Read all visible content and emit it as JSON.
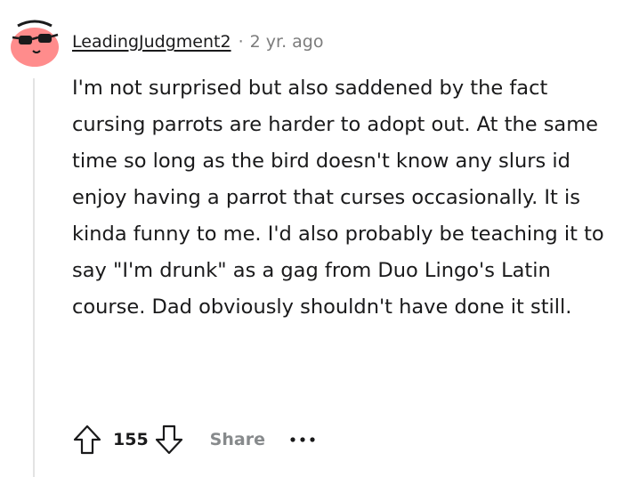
{
  "comment": {
    "author": "LeadingJudgment2",
    "separator": "·",
    "timestamp": "2 yr. ago",
    "body": "I'm not surprised but also saddened by the fact cursing parrots are harder to adopt out. At the same time so long as the bird doesn't know any slurs id enjoy having a parrot that curses occasionally. It is kinda funny to me. I'd also probably be teaching it to say \"I'm drunk\" as a gag from Duo Lingo's Latin course. Dad obviously shouldn't have done it still.",
    "avatar_icon": "snoo-avatar-icon"
  },
  "actions": {
    "upvote_icon": "upvote-arrow-icon",
    "score": "155",
    "downvote_icon": "downvote-arrow-icon",
    "share_label": "Share",
    "more_icon": "more-options-icon"
  },
  "colors": {
    "avatar_pink": "#ff8c8c",
    "text": "#1a1a1b",
    "meta_gray": "#7c7c7c",
    "action_gray": "#878a8c",
    "thread_line": "#e3e3e3"
  }
}
